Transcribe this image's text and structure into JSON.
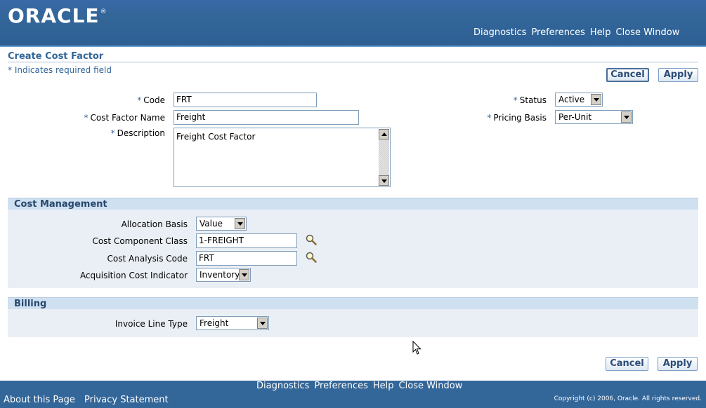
{
  "header": {
    "logo": "ORACLE",
    "logo_mark": "®",
    "links": [
      "Diagnostics",
      "Preferences",
      "Help",
      "Close Window"
    ]
  },
  "page": {
    "title": "Create Cost Factor",
    "required_note": "* Indicates required field",
    "cancel_label": "Cancel",
    "apply_label": "Apply"
  },
  "form": {
    "code": {
      "label": "Code",
      "value": "FRT"
    },
    "name": {
      "label": "Cost Factor Name",
      "value": "Freight"
    },
    "description": {
      "label": "Description",
      "value": "Freight Cost Factor"
    },
    "status": {
      "label": "Status",
      "value": "Active"
    },
    "pricing_basis": {
      "label": "Pricing Basis",
      "value": "Per-Unit"
    }
  },
  "cost_management": {
    "title": "Cost Management",
    "allocation_basis": {
      "label": "Allocation Basis",
      "value": "Value"
    },
    "component_class": {
      "label": "Cost Component Class",
      "value": "1-FREIGHT"
    },
    "analysis_code": {
      "label": "Cost Analysis Code",
      "value": "FRT"
    },
    "acquisition_indicator": {
      "label": "Acquisition Cost Indicator",
      "value": "Inventory"
    }
  },
  "billing": {
    "title": "Billing",
    "invoice_line_type": {
      "label": "Invoice Line Type",
      "value": "Freight"
    }
  },
  "footer": {
    "links": [
      "Diagnostics",
      "Preferences",
      "Help",
      "Close Window"
    ],
    "about": "About this Page",
    "privacy": "Privacy Statement",
    "copyright": "Copyright (c) 2006, Oracle. All rights reserved."
  },
  "colors": {
    "brand_blue": "#336699",
    "section_header": "#cfe0f1",
    "section_body": "#eaeff5"
  },
  "icons": {
    "lov": "magnifier-icon"
  }
}
